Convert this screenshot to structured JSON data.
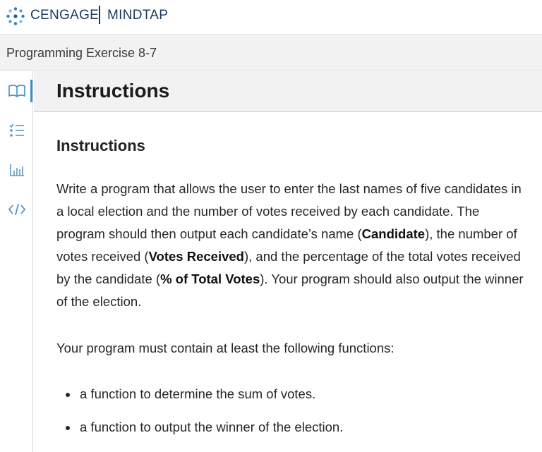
{
  "header": {
    "brand_left": "CENGAGE",
    "brand_right": "MINDTAP",
    "logo_icon": "cengage-logo-icon",
    "accent_color": "#3a8fc4"
  },
  "exercise": {
    "title": "Programming Exercise 8-7"
  },
  "sidebar": {
    "items": [
      {
        "icon": "book-icon",
        "active": true
      },
      {
        "icon": "checklist-icon",
        "active": false
      },
      {
        "icon": "bar-chart-icon",
        "active": false
      },
      {
        "icon": "code-icon",
        "active": false
      }
    ]
  },
  "main": {
    "title": "Instructions",
    "subheading": "Instructions",
    "paragraph1": {
      "t1": "Write a program that allows the user to enter the last names of five candidates in a local election and the number of votes received by each candidate. The program should then output each candidate’s name (",
      "b1": "Candidate",
      "t2": "), the number of votes received (",
      "b2": "Votes Received",
      "t3": "), and the percentage of the total votes received by the candidate (",
      "b3": "% of Total Votes",
      "t4": "). Your program should also output the winner of the election."
    },
    "paragraph2": "Your program must contain at least the following functions:",
    "bullets": [
      "a function to determine the sum of votes.",
      "a function to output the winner of the election."
    ]
  }
}
